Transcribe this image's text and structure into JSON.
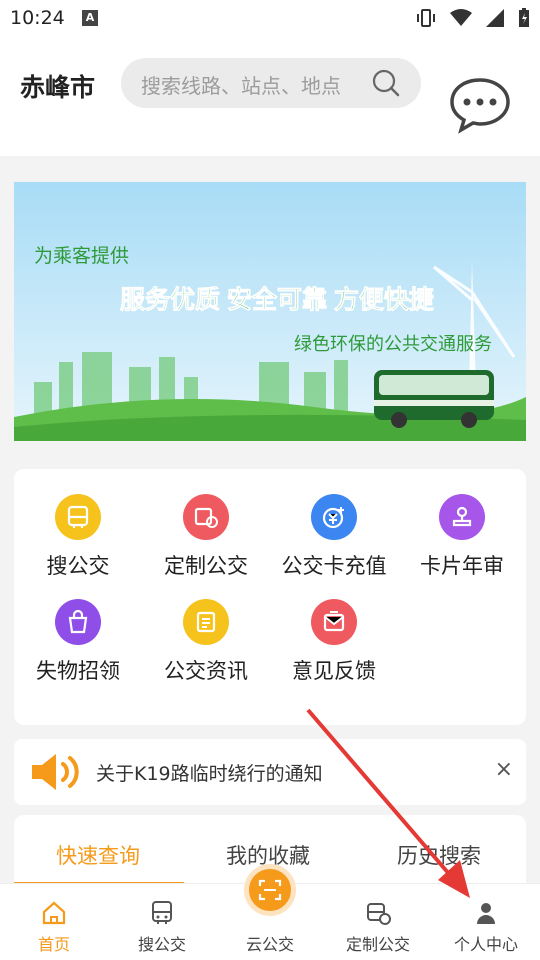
{
  "status_bar": {
    "time": "10:24",
    "a_icon": "A"
  },
  "header": {
    "city": "赤峰市",
    "search_placeholder": "搜索线路、站点、地点"
  },
  "banner": {
    "line1": "为乘客提供",
    "line2": "服务优质  安全可靠  方便快捷",
    "line3": "绿色环保的公共交通服务"
  },
  "grid": {
    "items": [
      {
        "label": "搜公交",
        "icon": "bus-search-icon",
        "color": "#f6c21c"
      },
      {
        "label": "定制公交",
        "icon": "custom-bus-icon",
        "color": "#ee5a5f"
      },
      {
        "label": "公交卡充值",
        "icon": "card-recharge-icon",
        "color": "#3b86f0"
      },
      {
        "label": "卡片年审",
        "icon": "stamp-icon",
        "color": "#a656e8"
      },
      {
        "label": "失物招领",
        "icon": "lost-bag-icon",
        "color": "#8f4ee8"
      },
      {
        "label": "公交资讯",
        "icon": "news-icon",
        "color": "#f6c21c"
      },
      {
        "label": "意见反馈",
        "icon": "feedback-icon",
        "color": "#ee5a5f"
      }
    ]
  },
  "notice": {
    "text": "关于K19路临时绕行的通知",
    "close": "×"
  },
  "tabs": [
    {
      "label": "快速查询"
    },
    {
      "label": "我的收藏"
    },
    {
      "label": "历史搜索"
    }
  ],
  "bottom_nav": [
    {
      "label": "首页"
    },
    {
      "label": "搜公交"
    },
    {
      "label": "云公交"
    },
    {
      "label": "定制公交"
    },
    {
      "label": "个人中心"
    }
  ],
  "colors": {
    "accent": "#f59a1b",
    "annotation_arrow": "#e53935"
  }
}
